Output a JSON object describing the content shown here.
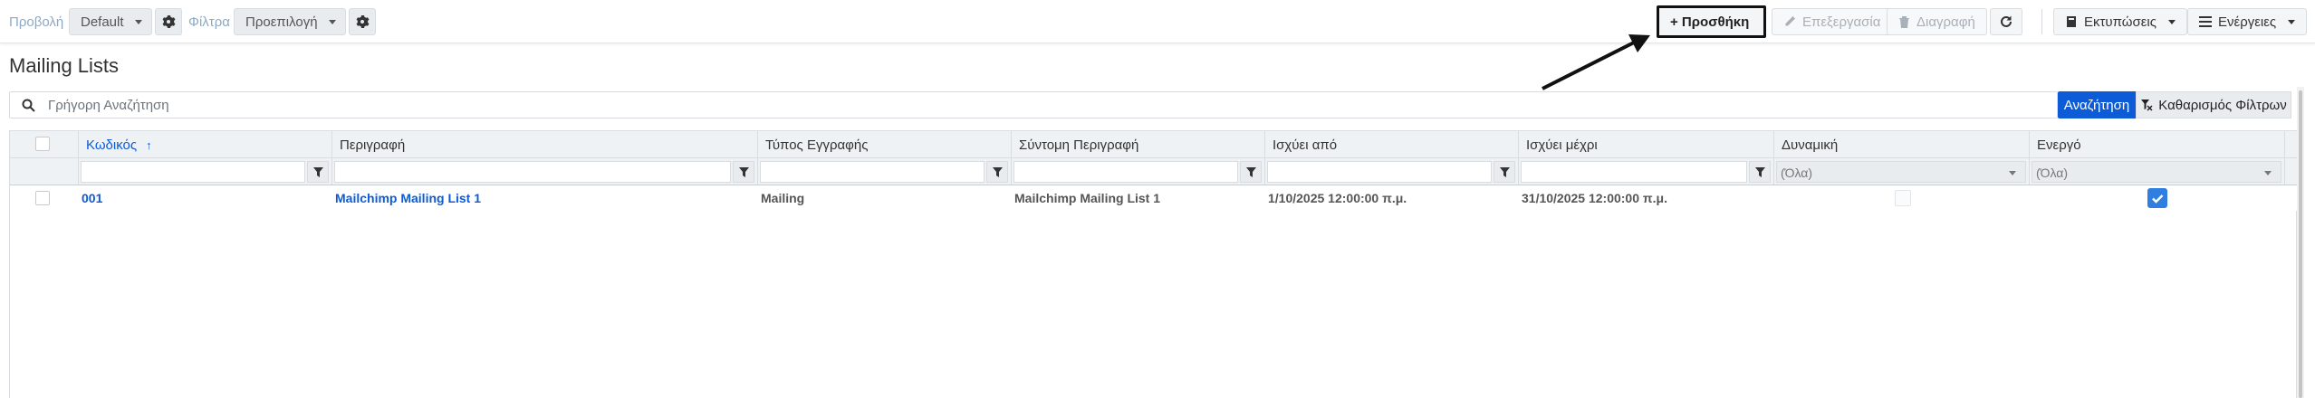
{
  "toolbar": {
    "view_label": "Προβολή",
    "view_value": "Default",
    "filter_label": "Φίλτρα",
    "filter_value": "Προεπιλογή",
    "add_label": "+ Προσθήκη",
    "edit_label": "Επεξεργασία",
    "delete_label": "Διαγραφή",
    "prints_label": "Εκτυπώσεις",
    "actions_label": "Ενέργειες"
  },
  "page": {
    "title": "Mailing Lists"
  },
  "search": {
    "placeholder": "Γρήγορη Αναζήτηση",
    "search_button": "Αναζήτηση",
    "clear_button": "Καθαρισμός Φίλτρων"
  },
  "grid": {
    "columns": [
      {
        "key": "code",
        "label": "Κωδικός",
        "sort": "↑"
      },
      {
        "key": "description",
        "label": "Περιγραφή"
      },
      {
        "key": "record_type",
        "label": "Τύπος Εγγραφής"
      },
      {
        "key": "short_description",
        "label": "Σύντομη Περιγραφή"
      },
      {
        "key": "valid_from",
        "label": "Ισχύει από"
      },
      {
        "key": "valid_to",
        "label": "Ισχύει μέχρι"
      },
      {
        "key": "dynamic",
        "label": "Δυναμική"
      },
      {
        "key": "active",
        "label": "Ενεργό"
      }
    ],
    "filters": {
      "dynamic": "(Όλα)",
      "active": "(Όλα)"
    },
    "rows": [
      {
        "code": "001",
        "description": "Mailchimp Mailing List 1",
        "record_type": "Mailing",
        "short_description": "Mailchimp Mailing List 1",
        "valid_from": "1/10/2025 12:00:00 π.μ.",
        "valid_to": "31/10/2025 12:00:00 π.μ.",
        "dynamic": false,
        "active": true
      }
    ]
  },
  "colors": {
    "primary": "#0d5bd7",
    "header_bg": "#eef2f5",
    "checkbox_on": "#2f7fe0"
  }
}
